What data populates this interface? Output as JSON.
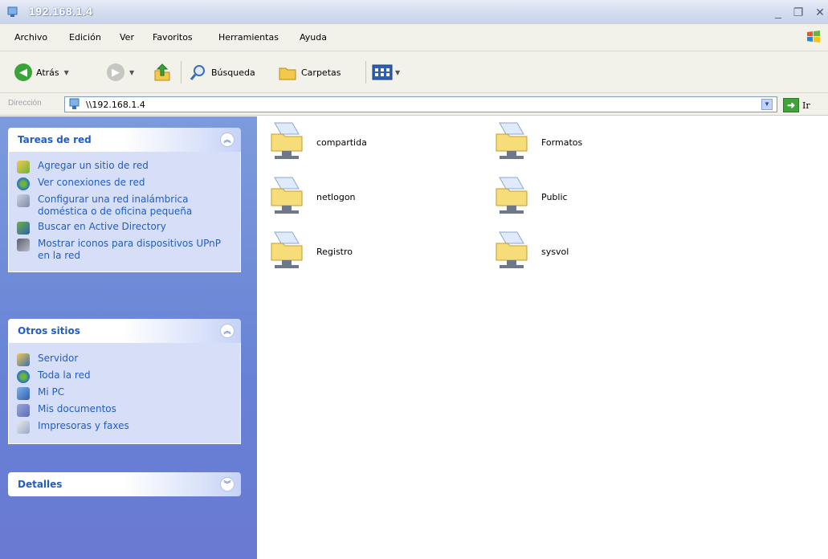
{
  "window": {
    "title": "192.168.1.4"
  },
  "menu": [
    {
      "label": "Archivo",
      "u": "A"
    },
    {
      "label": "Edición",
      "u": "E"
    },
    {
      "label": "Ver",
      "u": "V"
    },
    {
      "label": "Favoritos",
      "u": "F"
    },
    {
      "label": "Herramientas",
      "u": "H"
    },
    {
      "label": "Ayuda",
      "u": "u"
    }
  ],
  "toolbar": {
    "back_label": "Atrás",
    "search_label": "Búsqueda",
    "folders_label": "Carpetas"
  },
  "address": {
    "label": "Dirección",
    "value": "\\\\192.168.1.4",
    "go_label": "Ir"
  },
  "tasks_panel": {
    "title": "Tareas de red",
    "items": [
      {
        "label": "Agregar un sitio de red",
        "icon": "add-network-place-icon"
      },
      {
        "label": "Ver conexiones de red",
        "icon": "network-connections-icon"
      },
      {
        "label": "Configurar una red inalámbrica doméstica o de oficina pequeña",
        "icon": "wireless-setup-icon"
      },
      {
        "label": "Buscar en Active Directory",
        "icon": "directory-search-icon"
      },
      {
        "label": "Mostrar iconos para dispositivos UPnP en la red",
        "icon": "upnp-device-icon"
      }
    ]
  },
  "places_panel": {
    "title": "Otros sitios",
    "items": [
      {
        "label": "Servidor",
        "icon": "server-icon"
      },
      {
        "label": "Toda la red",
        "icon": "entire-network-icon"
      },
      {
        "label": "Mi PC",
        "icon": "my-computer-icon"
      },
      {
        "label": "Mis documentos",
        "icon": "my-documents-icon"
      },
      {
        "label": "Impresoras y faxes",
        "icon": "printers-icon"
      }
    ]
  },
  "details_panel": {
    "title": "Detalles"
  },
  "shares": [
    {
      "name": "compartida"
    },
    {
      "name": "Formatos"
    },
    {
      "name": "netlogon"
    },
    {
      "name": "Public"
    },
    {
      "name": "Registro"
    },
    {
      "name": "sysvol"
    }
  ],
  "colors": {
    "task_link": "#215dc6",
    "pane_bg": "#7c9bdc",
    "panel_body": "#d6dff7",
    "titlebar": "#d6deef"
  }
}
